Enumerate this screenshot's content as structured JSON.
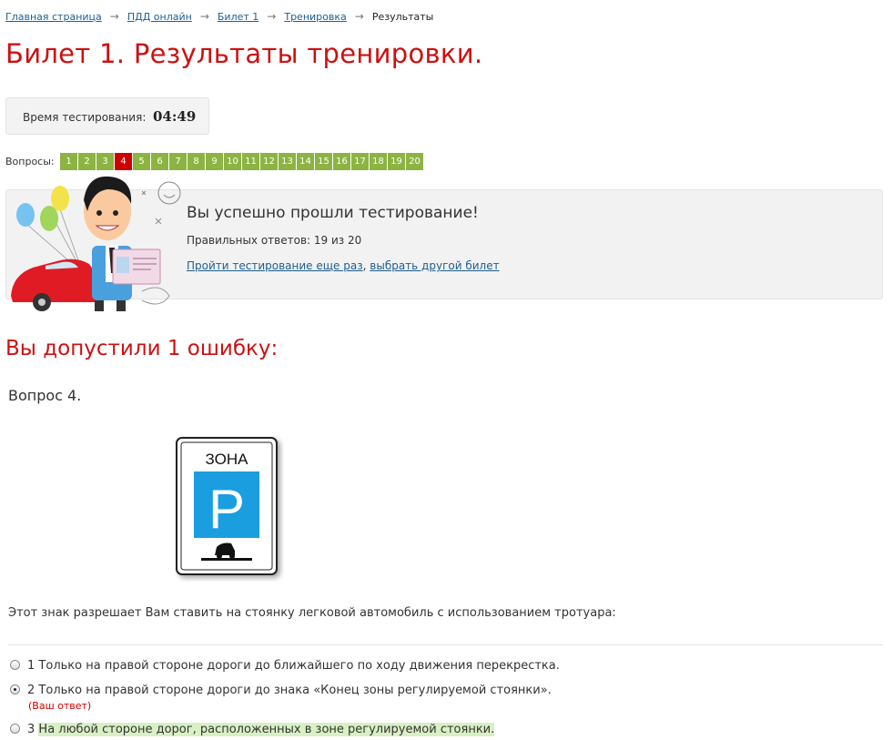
{
  "breadcrumbs": {
    "items": [
      "Главная страница",
      "ПДД онлайн",
      "Билет 1",
      "Тренировка"
    ],
    "current": "Результаты",
    "separator": "→"
  },
  "page_title": "Билет 1. Результаты тренировки.",
  "timer": {
    "label": "Время тестирования:",
    "value": "04:49"
  },
  "questions_nav": {
    "label": "Вопросы:",
    "items": [
      "1",
      "2",
      "3",
      "4",
      "5",
      "6",
      "7",
      "8",
      "9",
      "10",
      "11",
      "12",
      "13",
      "14",
      "15",
      "16",
      "17",
      "18",
      "19",
      "20"
    ],
    "error_item": "4",
    "colors": {
      "ok": "#8db343",
      "error": "#cc0000"
    }
  },
  "result": {
    "title": "Вы успешно прошли тестирование!",
    "score": "Правильных ответов: 19 из 20",
    "retry_link": "Пройти тестирование еще раз",
    "comma": ",",
    "other_ticket_link": "выбрать другой билет"
  },
  "errors_heading": "Вы допустили 1 ошибку:",
  "question": {
    "title": "Вопрос 4.",
    "sign": {
      "text": "ЗОНА",
      "letter": "P"
    },
    "text": "Этот знак разрешает Вам ставить на стоянку легковой автомобиль с использованием тротуара:",
    "answers": [
      {
        "num": "1",
        "text": "Только на правой стороне дороги до ближайшего по ходу движения перекрестка."
      },
      {
        "num": "2",
        "text": "Только на правой стороне дороги до знака «Конец зоны регулируемой стоянки»."
      },
      {
        "num": "3",
        "text": "На любой стороне дорог, расположенных в зоне регулируемой стоянки."
      }
    ],
    "your_answer_label": "(Ваш ответ)",
    "selected_answer": "2",
    "correct_answer": "3"
  }
}
